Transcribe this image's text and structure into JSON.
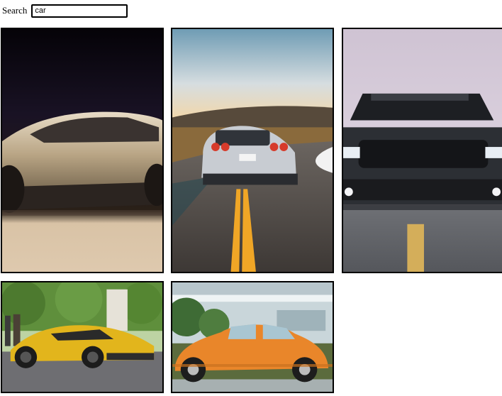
{
  "search": {
    "label": "Search",
    "value": "car"
  },
  "results": [
    {
      "subject": "beige-concept-car-side",
      "accent": "#c9b394"
    },
    {
      "subject": "silver-sports-car-rear-road",
      "accent": "#c8ccd2"
    },
    {
      "subject": "black-muscle-car-front",
      "accent": "#2c2f34"
    },
    {
      "subject": "yellow-supercar-side",
      "accent": "#e2b51c"
    },
    {
      "subject": "orange-beetle-side",
      "accent": "#e9862a"
    }
  ]
}
